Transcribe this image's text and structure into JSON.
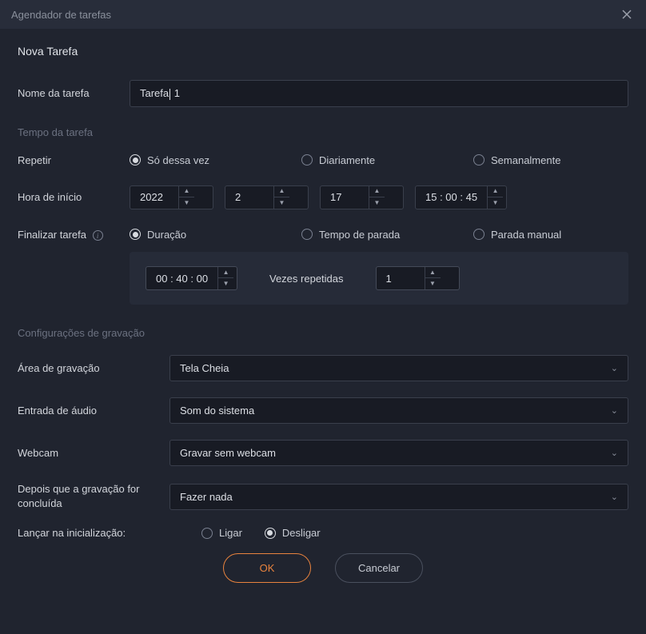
{
  "titlebar": {
    "title": "Agendador de tarefas"
  },
  "heading": "Nova Tarefa",
  "task_name": {
    "label": "Nome da tarefa",
    "value_pre": "Tarefa",
    "value_post": " 1"
  },
  "sections": {
    "time": "Tempo da tarefa",
    "recording": "Configurações de gravação"
  },
  "repeat": {
    "label": "Repetir",
    "options": [
      "Só dessa vez",
      "Diariamente",
      "Semanalmente"
    ],
    "selected": 0
  },
  "start_time": {
    "label": "Hora de início",
    "year": "2022",
    "month": "2",
    "day": "17",
    "time": "15 : 00 : 45"
  },
  "end_task": {
    "label": "Finalizar tarefa",
    "options": [
      "Duração",
      "Tempo de parada",
      "Parada manual"
    ],
    "selected": 0
  },
  "duration_panel": {
    "duration": "00 : 40 : 00",
    "repeat_label": "Vezes repetidas",
    "repeat_value": "1"
  },
  "rec_area": {
    "label": "Área de gravação",
    "value": "Tela Cheia"
  },
  "audio": {
    "label": "Entrada de áudio",
    "value": "Som do sistema"
  },
  "webcam": {
    "label": "Webcam",
    "value": "Gravar sem webcam"
  },
  "after": {
    "label": "Depois que a gravação for concluída",
    "value": "Fazer nada"
  },
  "launch": {
    "label": "Lançar na inicialização:",
    "options": [
      "Ligar",
      "Desligar"
    ],
    "selected": 1
  },
  "buttons": {
    "ok": "OK",
    "cancel": "Cancelar"
  }
}
